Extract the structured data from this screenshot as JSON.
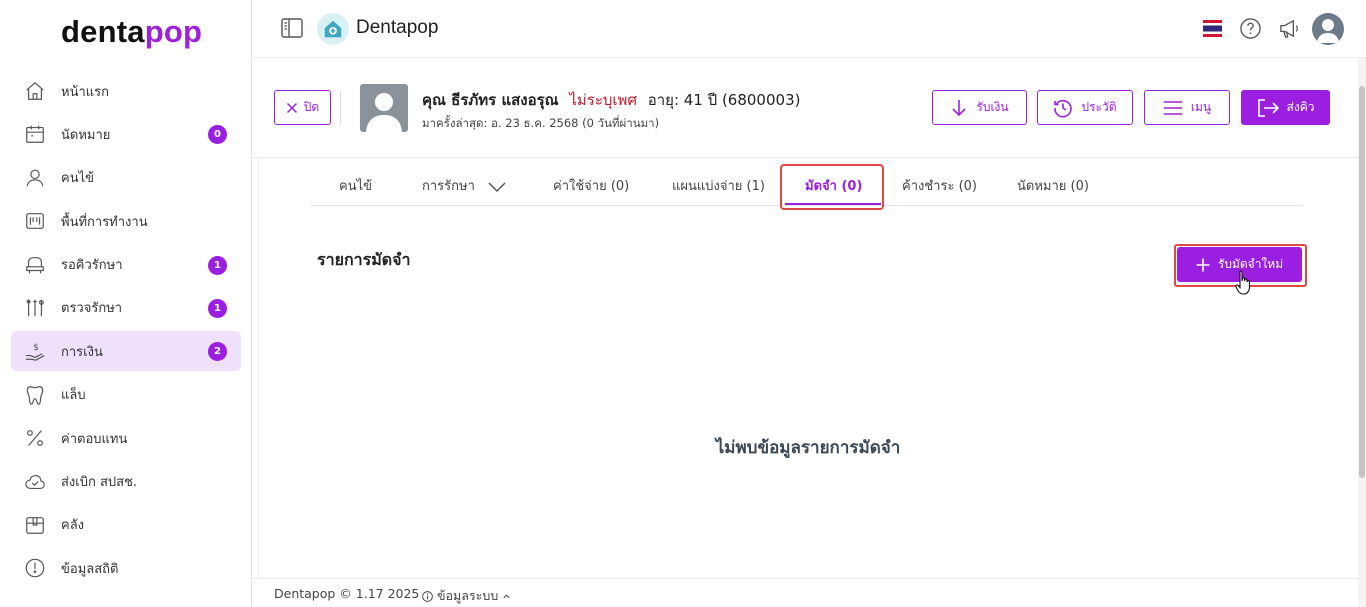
{
  "sidebar": {
    "logo_main": "denta",
    "logo_accent": "pop",
    "items": [
      {
        "label": "หน้าแรก",
        "icon": "home-icon",
        "badge": null,
        "active": false
      },
      {
        "label": "นัดหมาย",
        "icon": "calendar-icon",
        "badge": "0",
        "active": false
      },
      {
        "label": "คนไข้",
        "icon": "user-icon",
        "badge": null,
        "active": false
      },
      {
        "label": "พื้นที่การทำงาน",
        "icon": "workspace-icon",
        "badge": null,
        "active": false
      },
      {
        "label": "รอคิวรักษา",
        "icon": "dental-chair-icon",
        "badge": "1",
        "active": false
      },
      {
        "label": "ตรวจรักษา",
        "icon": "dental-tools-icon",
        "badge": "1",
        "active": false
      },
      {
        "label": "การเงิน",
        "icon": "money-hand-icon",
        "badge": "2",
        "active": true
      },
      {
        "label": "แล็บ",
        "icon": "tooth-icon",
        "badge": null,
        "active": false
      },
      {
        "label": "ค่าตอบแทน",
        "icon": "percent-icon",
        "badge": null,
        "active": false
      },
      {
        "label": "ส่งเบิก สปสช.",
        "icon": "cloud-check-icon",
        "badge": null,
        "active": false
      },
      {
        "label": "คลัง",
        "icon": "box-icon",
        "badge": null,
        "active": false
      },
      {
        "label": "ข้อมูลสถิติ",
        "icon": "stats-clock-icon",
        "badge": null,
        "active": false
      }
    ]
  },
  "topbar": {
    "brand": "Dentapop"
  },
  "patient": {
    "close_label": "ปิด",
    "name": "คุณ ธีรภัทร แสงอรุณ",
    "gender": "ไม่ระบุเพศ",
    "age": "อายุ: 41 ปี",
    "hn": "(6800003)",
    "last_visit": "มาครั้งล่าสุด: อ. 23 ธ.ค. 2568 (0 วันที่ผ่านมา)"
  },
  "actions": {
    "receive_money": "รับเงิน",
    "history": "ประวัติ",
    "menu": "เมนู",
    "send_queue": "ส่งคิว"
  },
  "tabs": [
    {
      "label": "คนไข้"
    },
    {
      "label": "การรักษา"
    },
    {
      "label": "ค่าใช้จ่าย (0)"
    },
    {
      "label": "แผนแบ่งจ่าย (1)"
    },
    {
      "label": "มัดจำ (0)"
    },
    {
      "label": "ค้างชำระ (0)"
    },
    {
      "label": "นัดหมาย (0)"
    }
  ],
  "active_tab": "มัดจำ (0)",
  "section": {
    "title": "รายการมัดจำ",
    "new_button": "รับมัดจำใหม่",
    "empty_message": "ไม่พบข้อมูลรายการมัดจำ"
  },
  "footer": {
    "copyright": "Dentapop © 1.17 2025",
    "system_info": "ข้อมูลระบบ"
  },
  "colors": {
    "accent": "#9b1fe0",
    "active_bg": "#f1e0fb",
    "gender_red": "#c0182a",
    "highlight": "#e04848"
  }
}
